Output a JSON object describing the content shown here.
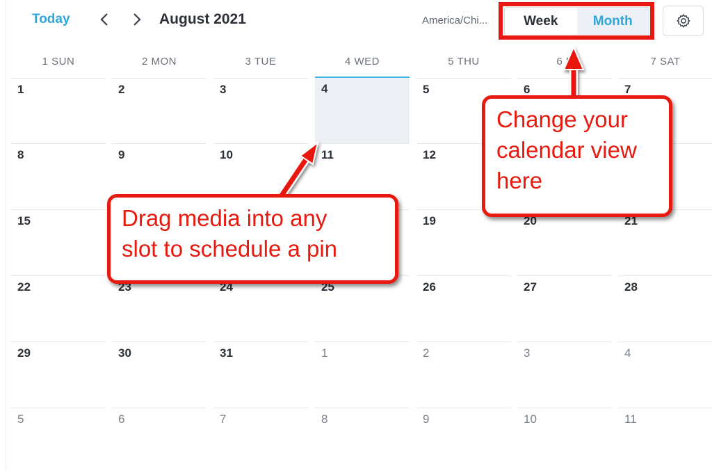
{
  "toolbar": {
    "today_label": "Today",
    "month_title": "August 2021",
    "timezone": "America/Chi...",
    "view_week_label": "Week",
    "view_month_label": "Month"
  },
  "calendar": {
    "weekdays": [
      "1 SUN",
      "2 MON",
      "3 TUE",
      "4 WED",
      "5 THU",
      "6 F",
      "7 SAT"
    ],
    "weeks": [
      [
        "1",
        "2",
        "3",
        "4",
        "5",
        "6",
        "7"
      ],
      [
        "8",
        "9",
        "10",
        "11",
        "12",
        "",
        ""
      ],
      [
        "15",
        "",
        "",
        "",
        "19",
        "20",
        "21"
      ],
      [
        "22",
        "23",
        "24",
        "25",
        "26",
        "27",
        "28"
      ],
      [
        "29",
        "30",
        "31",
        "1",
        "2",
        "3",
        "4"
      ],
      [
        "5",
        "6",
        "7",
        "8",
        "9",
        "10",
        "11"
      ]
    ],
    "other_month_from": 31
  },
  "annotations": {
    "drag_tip_line1": "Drag media into any",
    "drag_tip_line2": "slot to schedule a pin",
    "view_tip_line1": "Change your",
    "view_tip_line2": "calendar view",
    "view_tip_line3": "here"
  },
  "colors": {
    "accent": "#2ea6d9",
    "annotation_red": "#e8190f",
    "selected_cell": "#eceff4"
  }
}
